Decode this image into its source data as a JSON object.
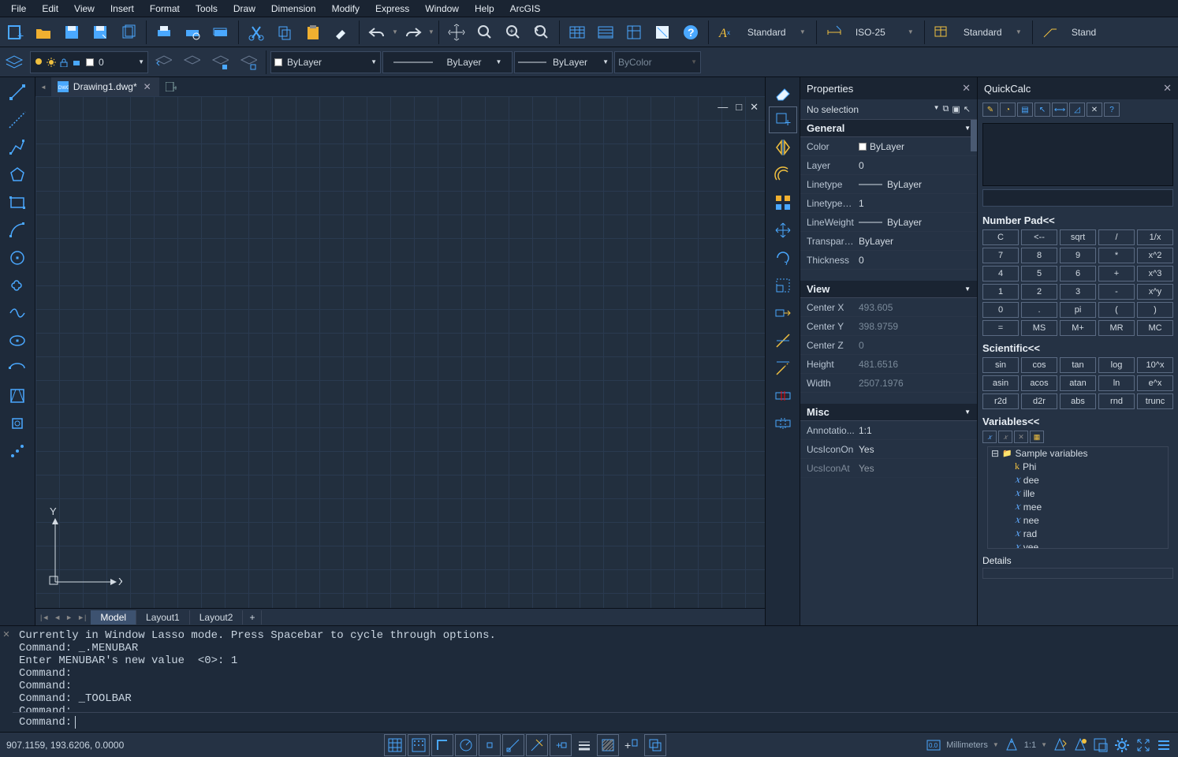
{
  "accent": "#4aa8ff",
  "menu": [
    "File",
    "Edit",
    "View",
    "Insert",
    "Format",
    "Tools",
    "Draw",
    "Dimension",
    "Modify",
    "Express",
    "Window",
    "Help",
    "ArcGIS"
  ],
  "styles": {
    "text": "Standard",
    "dim": "ISO-25",
    "table": "Standard",
    "mleader": "Stand"
  },
  "layer_combo": "0",
  "bylayer": {
    "color": "ByLayer",
    "ltype": "ByLayer",
    "lweight": "ByLayer",
    "plot": "ByColor"
  },
  "doc": {
    "name": "Drawing1.dwg*",
    "layouts": [
      "Model",
      "Layout1",
      "Layout2"
    ],
    "active_layout": "Model"
  },
  "properties": {
    "title": "Properties",
    "selection": "No selection",
    "general": {
      "Color": "ByLayer",
      "Layer": "0",
      "Linetype": "ByLayer",
      "LinetypeScale": "1",
      "LineWeight": "ByLayer",
      "Transparency": "ByLayer",
      "Thickness": "0"
    },
    "view": {
      "CenterX": "493.605",
      "CenterY": "398.9759",
      "CenterZ": "0",
      "Height": "481.6516",
      "Width": "2507.1976"
    },
    "misc": {
      "AnnotationScale": "1:1",
      "UcsIconOn": "Yes",
      "UcsIconAt": "Yes"
    }
  },
  "quickcalc": {
    "title": "QuickCalc",
    "sections": {
      "numpad": "Number Pad<<",
      "sci": "Scientific<<",
      "vars": "Variables<<"
    },
    "numpad": [
      [
        "C",
        "<--",
        "sqrt",
        "/",
        "1/x"
      ],
      [
        "7",
        "8",
        "9",
        "*",
        "x^2"
      ],
      [
        "4",
        "5",
        "6",
        "+",
        "x^3"
      ],
      [
        "1",
        "2",
        "3",
        "-",
        "x^y"
      ],
      [
        "0",
        ".",
        "pi",
        "(",
        ")"
      ],
      [
        "=",
        "MS",
        "M+",
        "MR",
        "MC"
      ]
    ],
    "sci": [
      [
        "sin",
        "cos",
        "tan",
        "log",
        "10^x"
      ],
      [
        "asin",
        "acos",
        "atan",
        "ln",
        "e^x"
      ],
      [
        "r2d",
        "d2r",
        "abs",
        "rnd",
        "trunc"
      ]
    ],
    "sample_folder": "Sample variables",
    "variables": [
      {
        "k": "k",
        "n": "Phi"
      },
      {
        "k": "x",
        "n": "dee"
      },
      {
        "k": "x",
        "n": "ille"
      },
      {
        "k": "x",
        "n": "mee"
      },
      {
        "k": "x",
        "n": "nee"
      },
      {
        "k": "x",
        "n": "rad"
      },
      {
        "k": "x",
        "n": "vee"
      }
    ],
    "details": "Details"
  },
  "command": {
    "history": [
      "Currently in Window Lasso mode. Press Spacebar to cycle through options.",
      "Command: _.MENUBAR",
      "Enter MENUBAR's new value  <0>: 1",
      "Command:",
      "Command:",
      "Command: _TOOLBAR",
      "Command:"
    ],
    "prompt": "Command:"
  },
  "status": {
    "coords": "907.1159, 193.6206, 0.0000",
    "units": "Millimeters",
    "scale": "1:1",
    "zero": "0.0"
  }
}
